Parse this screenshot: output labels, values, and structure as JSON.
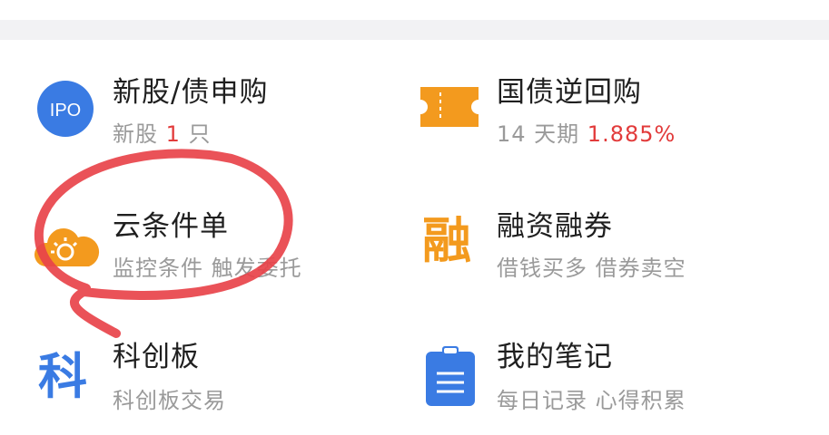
{
  "colors": {
    "accent_red": "#e23b3b",
    "blue": "#3a7be3",
    "orange": "#f39a1e",
    "annotation": "#e8434a"
  },
  "items": [
    {
      "title": "新股/债申购",
      "sub_prefix": "新股 ",
      "sub_highlight": "1",
      "sub_suffix": " 只",
      "icon": "ipo-icon",
      "icon_text": "IPO"
    },
    {
      "title": "国债逆回购",
      "sub_prefix": "14 天期 ",
      "sub_highlight": "1.885%",
      "sub_suffix": "",
      "icon": "ticket-icon"
    },
    {
      "title": "云条件单",
      "sub": "监控条件 触发委托",
      "icon": "cloud-sun-icon"
    },
    {
      "title": "融资融券",
      "sub": "借钱买多 借券卖空",
      "icon": "rong-char-icon",
      "icon_text": "融"
    },
    {
      "title": "科创板",
      "sub": "科创板交易",
      "icon": "ke-char-icon",
      "icon_text": "科"
    },
    {
      "title": "我的笔记",
      "sub": "每日记录 心得积累",
      "icon": "clipboard-icon"
    }
  ]
}
